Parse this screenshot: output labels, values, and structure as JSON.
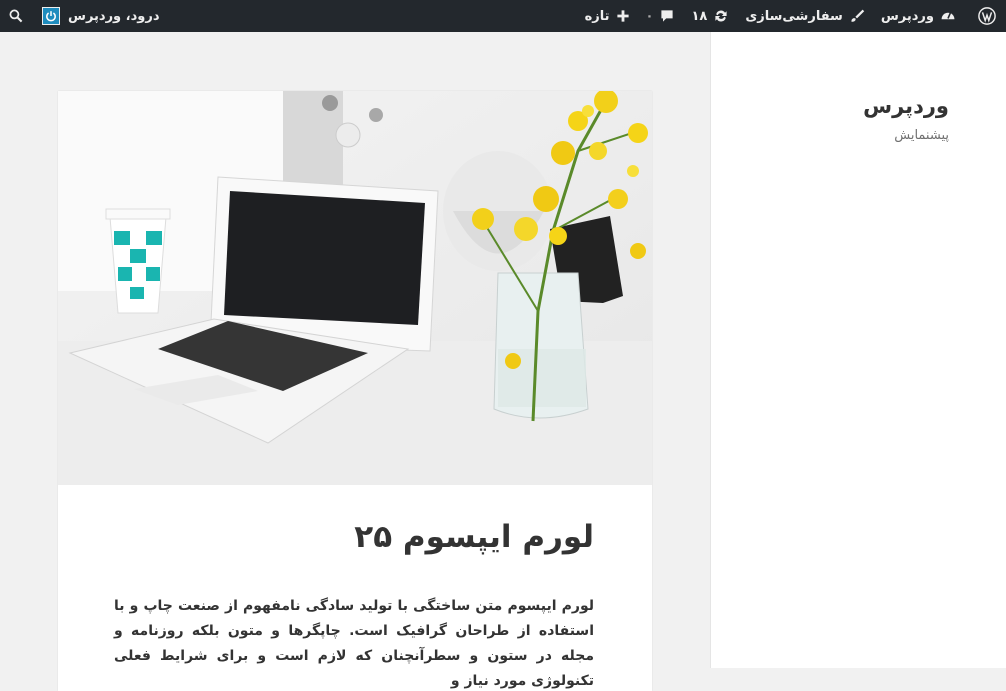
{
  "adminbar": {
    "site_name": "وردپرس",
    "customize": "سفارشی‌سازی",
    "updates_count": "۱۸",
    "comments_count": "۰",
    "new_label": "تازه",
    "greeting": "درود، وردپرس"
  },
  "icons": {
    "wp": "wordpress-logo-icon",
    "dashboard": "dashboard-icon",
    "brush": "brush-icon",
    "updates": "refresh-icon",
    "comments": "comment-icon",
    "plus": "plus-icon",
    "power": "power-icon",
    "search": "search-icon"
  },
  "sidebar": {
    "title": "وردپرس",
    "description": "پیشنمایش"
  },
  "post": {
    "title": "لورم ایپسوم ۲۵",
    "excerpt": "لورم ایپسوم متن ساختگی با تولید سادگی نامفهوم از صنعت چاپ و با استفاده از طراحان گرافیک است. چاپگرها و متون بلکه روزنامه و مجله در ستون و سطرآنچنان که لازم است و برای شرایط فعلی تکنولوژی مورد نیاز و"
  },
  "colors": {
    "adminbar": "#23282d",
    "accent": "#1e8cbe",
    "background": "#f1f1f1"
  }
}
